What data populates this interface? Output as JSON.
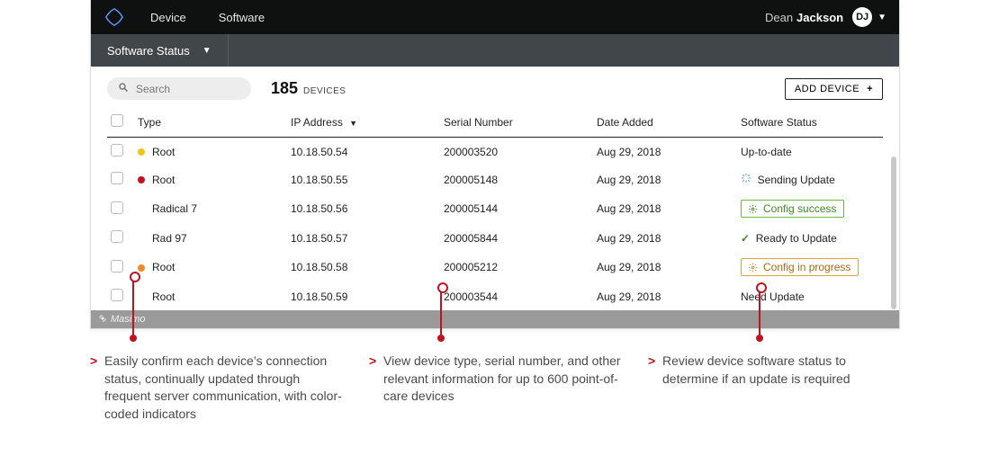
{
  "nav": {
    "device_label": "Device",
    "software_label": "Software"
  },
  "user": {
    "first": "Dean",
    "last": "Jackson",
    "initials": "DJ"
  },
  "subbar": {
    "dropdown_label": "Software Status"
  },
  "toolbar": {
    "search_placeholder": "Search",
    "count": "185",
    "count_label": "DEVICES",
    "add_device_label": "ADD DEVICE"
  },
  "columns": {
    "type": "Type",
    "ip": "IP Address",
    "sn": "Serial Number",
    "date": "Date Added",
    "soft": "Software Status"
  },
  "rows": [
    {
      "dot": "#f0c419",
      "type": "Root",
      "ip": "10.18.50.54",
      "sn": "200003520",
      "date": "Aug 29, 2018",
      "soft_kind": "text",
      "soft": "Up-to-date"
    },
    {
      "dot": "#c1121f",
      "type": "Root",
      "ip": "10.18.50.55",
      "sn": "200005148",
      "date": "Aug 29, 2018",
      "soft_kind": "spinner",
      "soft": "Sending Update"
    },
    {
      "dot": "",
      "type": "Radical 7",
      "ip": "10.18.50.56",
      "sn": "200005144",
      "date": "Aug 29, 2018",
      "soft_kind": "pill-green",
      "soft": "Config success"
    },
    {
      "dot": "",
      "type": "Rad 97",
      "ip": "10.18.50.57",
      "sn": "200005844",
      "date": "Aug 29, 2018",
      "soft_kind": "check",
      "soft": "Ready to Update"
    },
    {
      "dot": "#f08a24",
      "type": "Root",
      "ip": "10.18.50.58",
      "sn": "200005212",
      "date": "Aug 29, 2018",
      "soft_kind": "pill-orange",
      "soft": "Config in progress"
    },
    {
      "dot": "",
      "type": "Root",
      "ip": "10.18.50.59",
      "sn": "200003544",
      "date": "Aug 29, 2018",
      "soft_kind": "text",
      "soft": "Need Update"
    }
  ],
  "footer_brand": "Masimo",
  "callouts": {
    "c1": "Easily confirm each device’s connection status, continually updated through frequent server communication, with color-coded indicators",
    "c2": "View device type, serial number, and other relevant information for up to 600 point-of-care devices",
    "c3": "Review device software status to determine if an update is required"
  }
}
